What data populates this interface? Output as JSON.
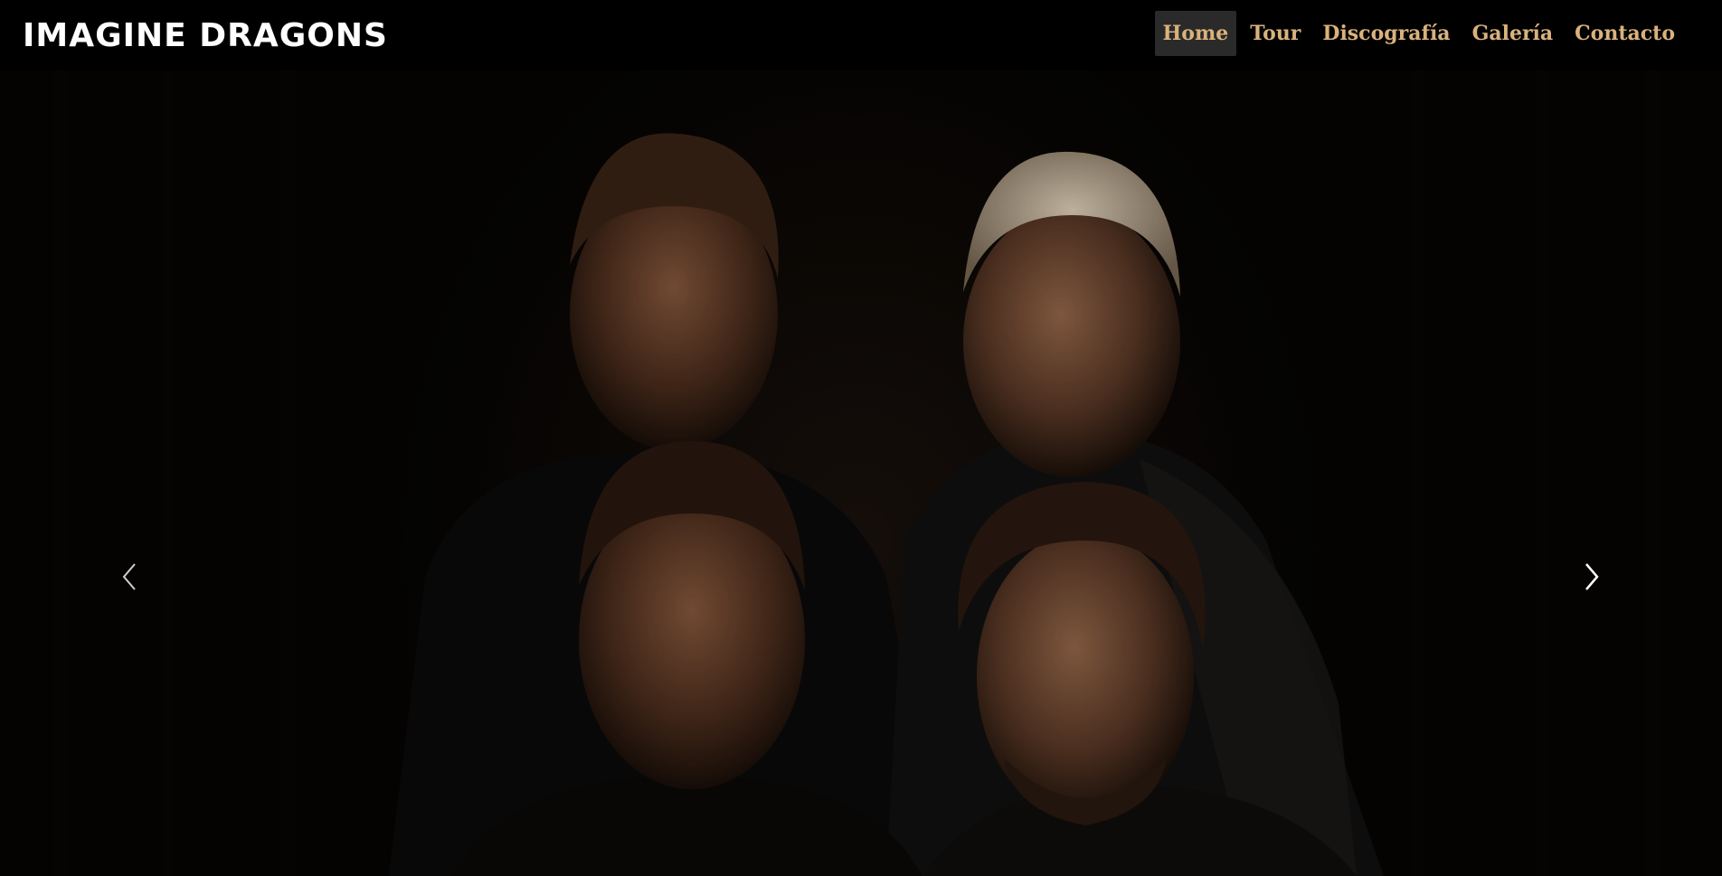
{
  "brand": {
    "logo_text": "IMAGINE DRAGONS"
  },
  "nav": {
    "items": [
      {
        "label": "Home",
        "active": true
      },
      {
        "label": "Tour",
        "active": false
      },
      {
        "label": "Discografía",
        "active": false
      },
      {
        "label": "Galería",
        "active": false
      },
      {
        "label": "Contacto",
        "active": false
      }
    ]
  },
  "carousel": {
    "prev_icon": "chevron-left-icon",
    "next_icon": "chevron-right-icon"
  },
  "colors": {
    "nav_background": "#000000",
    "nav_link": "#d9b27c",
    "nav_active_background": "#2a2a2a",
    "page_background": "#000000"
  }
}
